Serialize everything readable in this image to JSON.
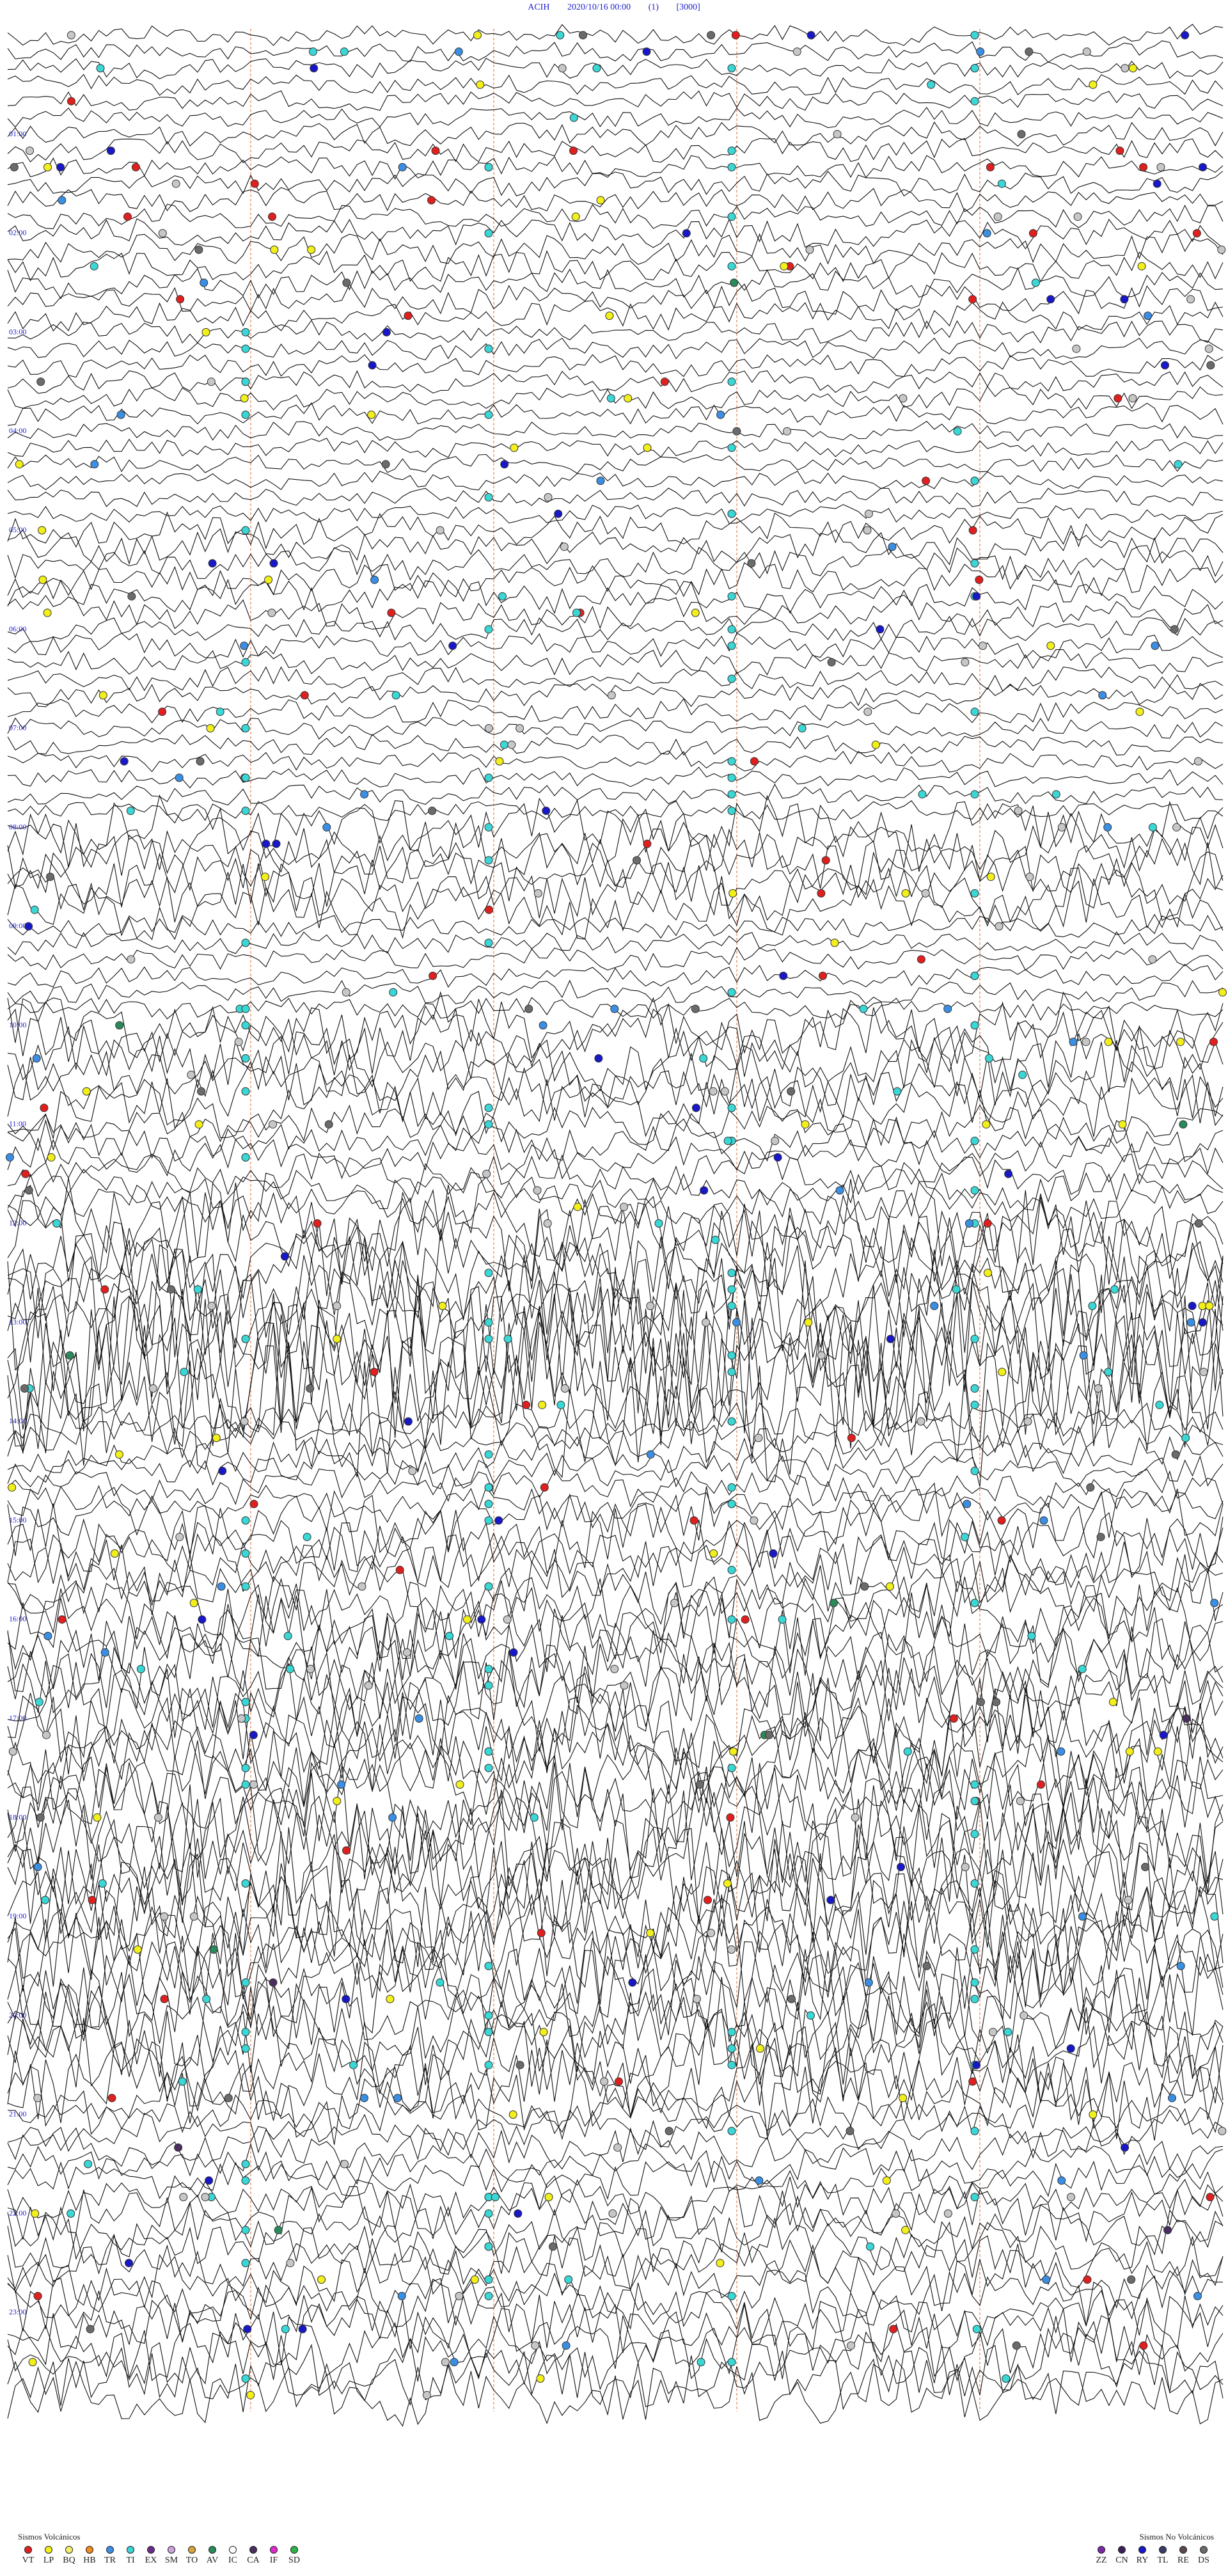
{
  "header": {
    "station": "ACIH",
    "datetime": "2020/10/16 00:00",
    "index": "(1)",
    "gain": "[3000]"
  },
  "chart_data": {
    "type": "line",
    "title": "ACIH 2020/10/16 00:00 (1) [3000]",
    "trace_count": 144,
    "minutes_per_trace": 10,
    "hour_labels": [
      "01:00",
      "02:00",
      "03:00",
      "04:00",
      "05:00",
      "06:00",
      "07:00",
      "08:00",
      "09:00",
      "10:00",
      "11:00",
      "12:00",
      "13:00",
      "14:00",
      "15:00",
      "16:00",
      "17:00",
      "18:00",
      "19:00",
      "20:00",
      "21:00",
      "22:00",
      "23:00"
    ],
    "grid_positions_fraction": [
      0.2,
      0.4,
      0.6,
      0.8
    ],
    "amplitude_by_hour": [
      1.1,
      1.3,
      1.6,
      1.2,
      1.0,
      1.8,
      1.3,
      1.1,
      3.2,
      1.2,
      3.5,
      2.2,
      5.2,
      8.5,
      2.0,
      3.8,
      4.5,
      5.0,
      6.5,
      5.5,
      4.8,
      2.2,
      3.0,
      3.6
    ],
    "events": [
      {
        "type": "VT",
        "color": "#e0201f",
        "counts_by_hour": [
          2,
          10,
          6,
          2,
          1,
          4,
          2,
          2,
          4,
          3,
          2,
          1,
          3,
          2,
          4,
          3,
          2,
          3,
          4,
          2,
          3,
          1,
          2,
          2
        ]
      },
      {
        "type": "LP",
        "color": "#f2ef1a",
        "counts_by_hour": [
          4,
          3,
          5,
          4,
          3,
          5,
          3,
          3,
          4,
          2,
          3,
          6,
          4,
          4,
          3,
          4,
          2,
          5,
          2,
          3,
          3,
          4,
          5,
          3
        ]
      },
      {
        "type": "TI",
        "color": "#39d7d5",
        "counts_by_hour": [
          12,
          6,
          4,
          10,
          8,
          6,
          8,
          14,
          5,
          9,
          10,
          8,
          12,
          14,
          8,
          10,
          12,
          10,
          6,
          8,
          14,
          10,
          12,
          6
        ]
      },
      {
        "type": "TR",
        "color": "#3a8fe4",
        "counts_by_hour": [
          2,
          2,
          3,
          2,
          2,
          2,
          3,
          2,
          2,
          2,
          3,
          2,
          2,
          3,
          2,
          3,
          2,
          3,
          2,
          3,
          3,
          2,
          3,
          2
        ]
      },
      {
        "type": "IC",
        "color": "#c7c7c7",
        "counts_by_hour": [
          5,
          6,
          4,
          5,
          3,
          4,
          4,
          5,
          5,
          4,
          5,
          5,
          4,
          6,
          5,
          4,
          6,
          5,
          4,
          5,
          4,
          6,
          5,
          4
        ]
      },
      {
        "type": "RY",
        "color": "#1818c8",
        "counts_by_hour": [
          4,
          4,
          3,
          3,
          2,
          3,
          2,
          2,
          2,
          2,
          2,
          3,
          2,
          2,
          2,
          2,
          3,
          2,
          2,
          2,
          2,
          2,
          2,
          2
        ]
      },
      {
        "type": "AV",
        "color": "#2a8a5a",
        "counts_by_hour": [
          0,
          0,
          1,
          0,
          0,
          0,
          0,
          0,
          0,
          0,
          1,
          1,
          0,
          1,
          0,
          1,
          0,
          1,
          0,
          1,
          0,
          0,
          1,
          0
        ]
      },
      {
        "type": "DS",
        "color": "#6b6b6b",
        "counts_by_hour": [
          3,
          2,
          2,
          2,
          2,
          2,
          2,
          2,
          2,
          2,
          2,
          2,
          2,
          2,
          2,
          2,
          2,
          2,
          2,
          2,
          2,
          2,
          2,
          2
        ]
      },
      {
        "type": "CA",
        "color": "#4a2e5e",
        "counts_by_hour": [
          0,
          0,
          0,
          0,
          0,
          0,
          0,
          0,
          0,
          0,
          0,
          0,
          0,
          0,
          0,
          0,
          0,
          1,
          0,
          1,
          0,
          1,
          1,
          0
        ]
      }
    ],
    "legend_left": {
      "title": "Sismos Volcánicos",
      "items": [
        {
          "code": "VT",
          "color": "#e0201f"
        },
        {
          "code": "LP",
          "color": "#f2ef1a"
        },
        {
          "code": "BQ",
          "color": "#f7f06d"
        },
        {
          "code": "HB",
          "color": "#f28a1c"
        },
        {
          "code": "TR",
          "color": "#3a8fe4"
        },
        {
          "code": "TI",
          "color": "#39d7d5"
        },
        {
          "code": "EX",
          "color": "#6a2c8a"
        },
        {
          "code": "SM",
          "color": "#cfa3e0"
        },
        {
          "code": "TO",
          "color": "#d9a43a"
        },
        {
          "code": "AV",
          "color": "#2a8a5a"
        },
        {
          "code": "IC",
          "color": "#ffffff"
        },
        {
          "code": "CA",
          "color": "#4a2e5e"
        },
        {
          "code": "IF",
          "color": "#e02ad0"
        },
        {
          "code": "SD",
          "color": "#2fb34a"
        }
      ]
    },
    "legend_right": {
      "title": "Sismos No Volcánicos",
      "items": [
        {
          "code": "ZZ",
          "color": "#7a2aa8"
        },
        {
          "code": "CN",
          "color": "#3b1f5a"
        },
        {
          "code": "RY",
          "color": "#1818c8"
        },
        {
          "code": "TL",
          "color": "#3a3a6a"
        },
        {
          "code": "RE",
          "color": "#5a4a4a"
        },
        {
          "code": "DS",
          "color": "#6b6b6b"
        }
      ]
    }
  }
}
